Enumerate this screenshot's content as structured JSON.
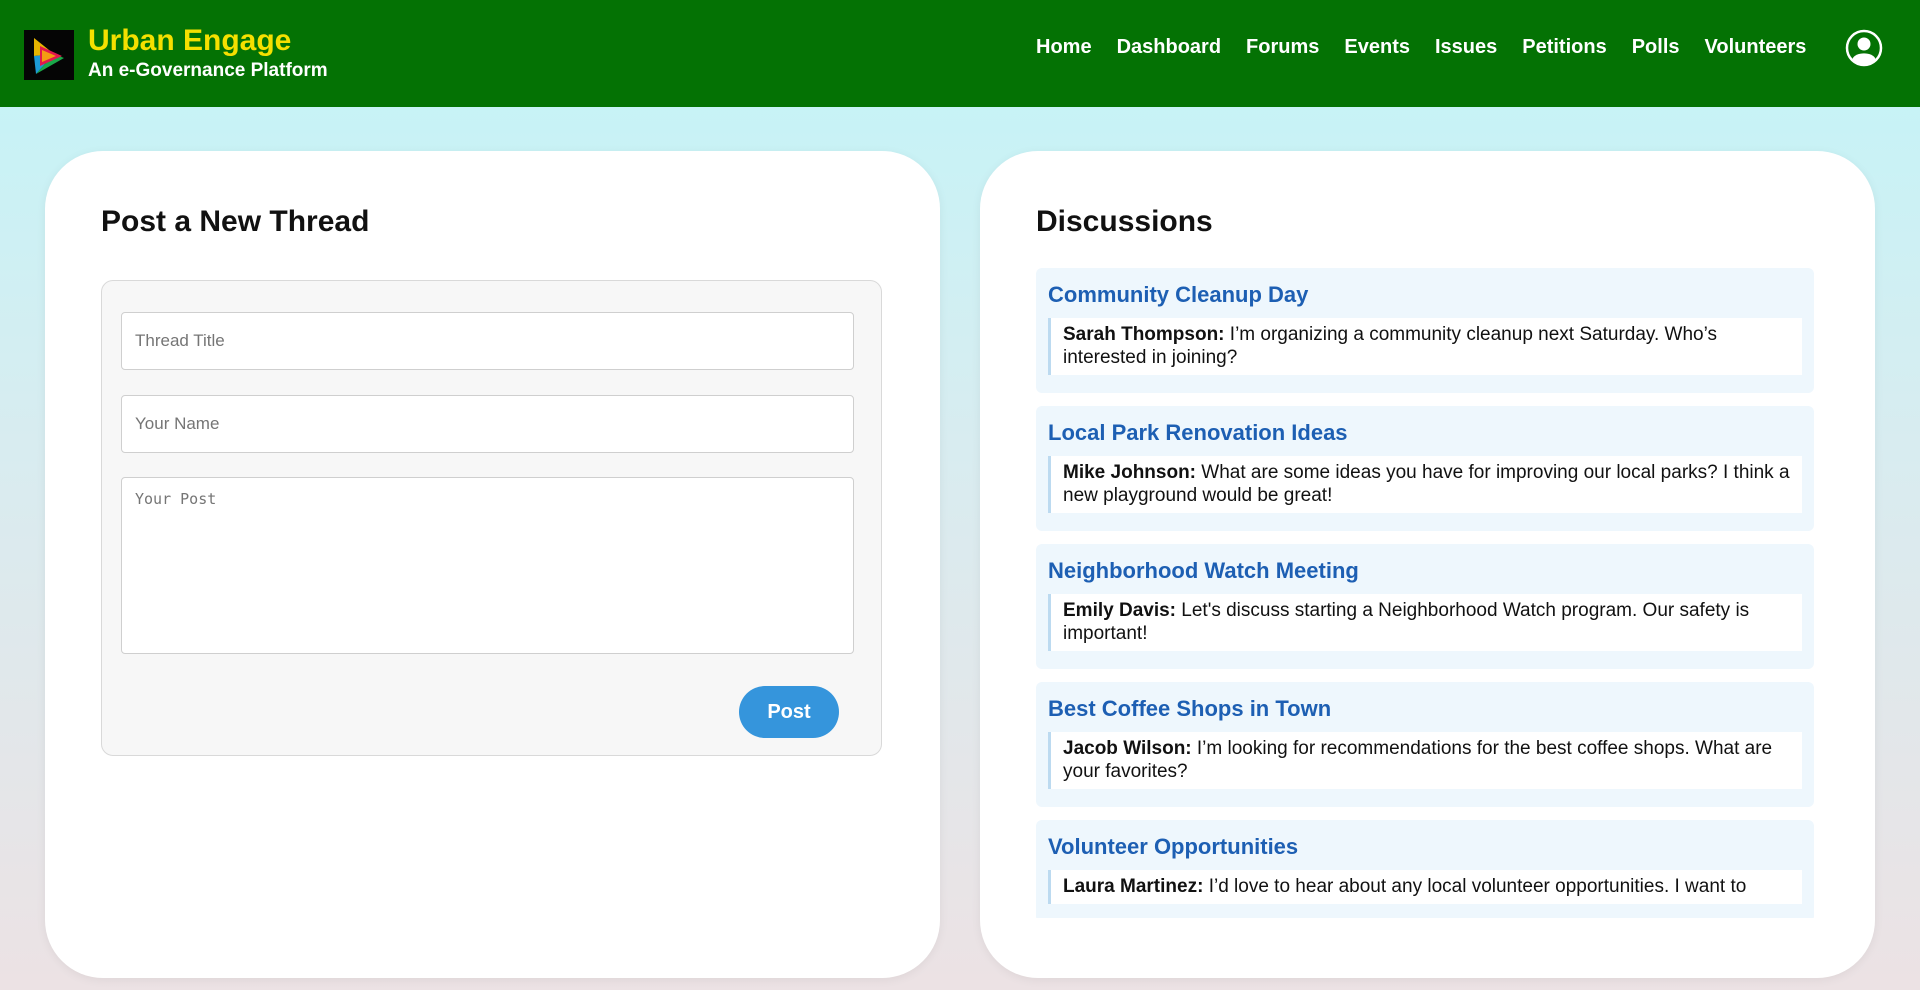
{
  "header": {
    "brand_title": "Urban Engage",
    "brand_subtitle": "An e-Governance Platform",
    "nav": [
      "Home",
      "Dashboard",
      "Forums",
      "Events",
      "Issues",
      "Petitions",
      "Polls",
      "Volunteers"
    ]
  },
  "form": {
    "title": "Post a New Thread",
    "thread_title_placeholder": "Thread Title",
    "name_placeholder": "Your Name",
    "post_placeholder": "Your Post",
    "post_button": "Post"
  },
  "discussions": {
    "title": "Discussions",
    "threads": [
      {
        "title": "Community Cleanup Day",
        "author": "Sarah Thompson:",
        "text": " I’m organizing a community cleanup next Saturday. Who’s interested in joining?"
      },
      {
        "title": "Local Park Renovation Ideas",
        "author": "Mike Johnson:",
        "text": " What are some ideas you have for improving our local parks? I think a new playground would be great!"
      },
      {
        "title": "Neighborhood Watch Meeting",
        "author": "Emily Davis:",
        "text": " Let's discuss starting a Neighborhood Watch program. Our safety is important!"
      },
      {
        "title": "Best Coffee Shops in Town",
        "author": "Jacob Wilson:",
        "text": " I’m looking for recommendations for the best coffee shops. What are your favorites?"
      },
      {
        "title": "Volunteer Opportunities",
        "author": "Laura Martinez:",
        "text": " I’d love to hear about any local volunteer opportunities. I want to"
      }
    ]
  },
  "colors": {
    "header_bg": "#047204",
    "brand_title": "#f5e000",
    "post_button": "#3595dc",
    "thread_title": "#1d5fb3",
    "thread_bg": "#eef7fd"
  },
  "icons": {
    "logo": "play-logo-icon",
    "user": "user-circle-icon"
  }
}
